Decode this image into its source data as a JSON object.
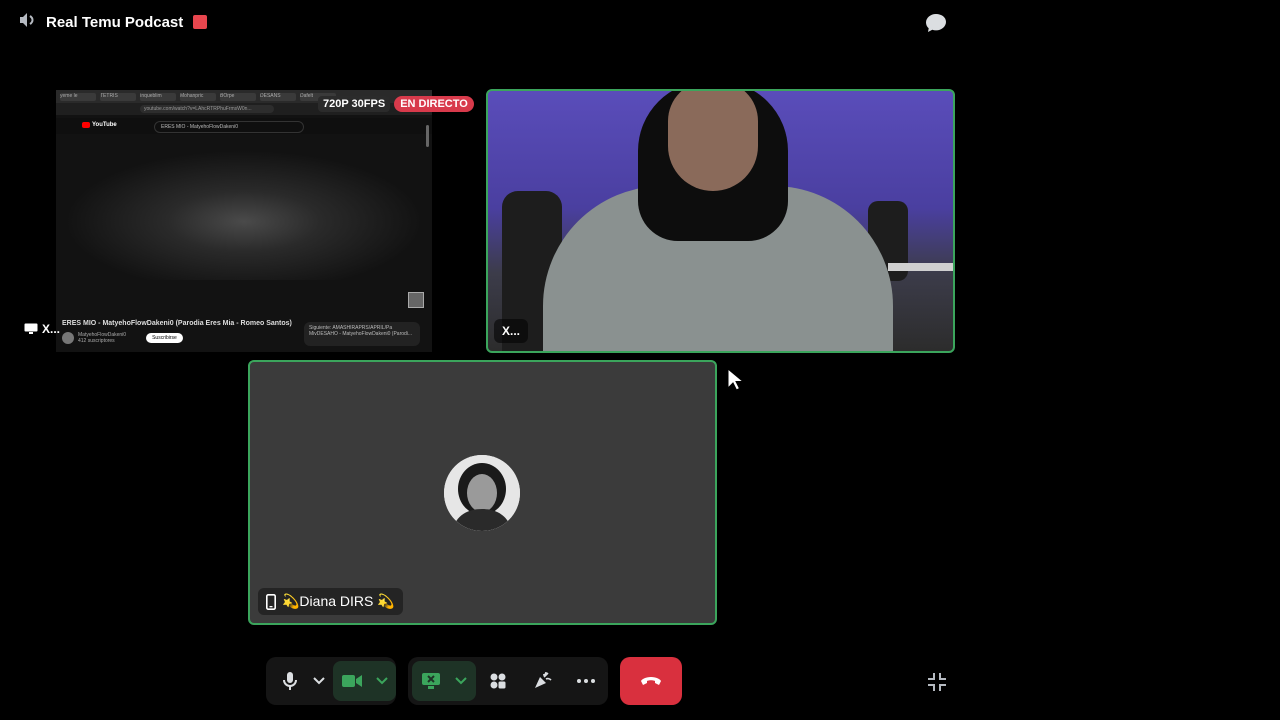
{
  "header": {
    "title": "Real Temu Podcast"
  },
  "share": {
    "resolution_badge": "720P 30FPS",
    "live_badge": "EN DIRECTO",
    "user_label": "X...",
    "browser_tabs": [
      "yeme le",
      "TETRIS",
      "Inqueblim",
      "Mohanpric",
      "BOrpe",
      "DESANS",
      "Dafelt"
    ],
    "url": "youtube.com/watch?v=LAhcRTRPhuFrmsW0n...",
    "youtube_label": "YouTube",
    "search_text": "ERES MIO - MatyehoFlowDakeni0",
    "video_title": "ERES MIO - MatyehoFlowDakeni0 (Parodia Eres Mia - Romeo Santos)",
    "channel_name": "MatyehoFlowDakeni0",
    "channel_subs": "412 suscriptores",
    "subscribe_label": "Suscribirse",
    "next_label": "Siguiente: AMASHIRAPRS/APRIL/Pa",
    "next_sub": "MivDESAHO - MatyehoFlowDakeni0 (Parodi..."
  },
  "camera": {
    "name": "X..."
  },
  "diana": {
    "name": "💫Diana DIRS 💫"
  },
  "colors": {
    "speaking_border": "#3ba55c",
    "end_call": "#d9303e",
    "live_badge": "#d83a4b"
  }
}
